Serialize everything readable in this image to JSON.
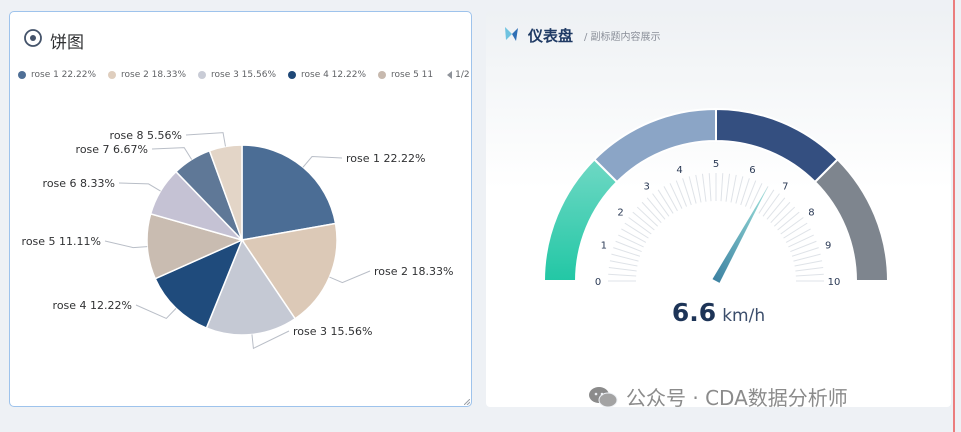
{
  "pie_panel": {
    "title": "饼图",
    "legend": [
      {
        "label": "rose 1 22.22%",
        "color": "#4f6f96"
      },
      {
        "label": "rose 2 18.33%",
        "color": "#dfcebe"
      },
      {
        "label": "rose 3 15.56%",
        "color": "#c9ccd6"
      },
      {
        "label": "rose 4 12.22%",
        "color": "#1f4877"
      },
      {
        "label": "rose 5 11",
        "color": "#c7b9ae"
      }
    ],
    "pager": "1/2"
  },
  "chart_data": {
    "type": "pie",
    "slices": [
      {
        "name": "rose 1",
        "label": "rose 1 22.22%",
        "value": 22.22,
        "color": "#4b6d95"
      },
      {
        "name": "rose 2",
        "label": "rose 2 18.33%",
        "value": 18.33,
        "color": "#dcc9b7"
      },
      {
        "name": "rose 3",
        "label": "rose 3 15.56%",
        "value": 15.56,
        "color": "#c5c9d4"
      },
      {
        "name": "rose 4",
        "label": "rose 4 12.22%",
        "value": 12.22,
        "color": "#1f4b7c"
      },
      {
        "name": "rose 5",
        "label": "rose 5 11.11%",
        "value": 11.11,
        "color": "#c9bcb1"
      },
      {
        "name": "rose 6",
        "label": "rose 6 8.33%",
        "value": 8.33,
        "color": "#c5c2d4"
      },
      {
        "name": "rose 7",
        "label": "rose 7 6.67%",
        "value": 6.67,
        "color": "#5f7897"
      },
      {
        "name": "rose 8",
        "label": "rose 8 5.56%",
        "value": 5.56,
        "color": "#e3d5c7"
      }
    ]
  },
  "gauge_panel": {
    "title": "仪表盘",
    "subtitle": "/ 副标题内容展示",
    "value": 6.6,
    "value_text": "6.6",
    "unit": "km/h",
    "min": 0,
    "max": 10,
    "ticks": [
      "0",
      "1",
      "2",
      "3",
      "4",
      "5",
      "6",
      "7",
      "8",
      "9",
      "10"
    ],
    "bands": [
      {
        "from": 0,
        "to": 2.5,
        "color": "#3fcdb0"
      },
      {
        "from": 2.5,
        "to": 5,
        "color": "#8ba5c6"
      },
      {
        "from": 5,
        "to": 7.5,
        "color": "#344f80"
      },
      {
        "from": 7.5,
        "to": 10,
        "color": "#7e858e"
      }
    ]
  },
  "watermark": {
    "text": "公众号 · CDA数据分析师"
  }
}
